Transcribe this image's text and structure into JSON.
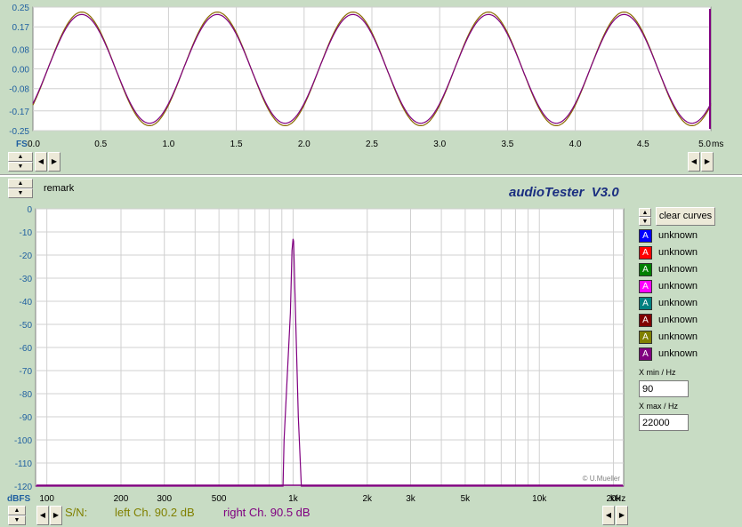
{
  "app": {
    "title": "audioTester  V3.0",
    "copyright": "© U.Mueller",
    "remark_label": "remark"
  },
  "time_plot": {
    "fs_label": "FS",
    "unit": "ms",
    "y_ticks": [
      "0.25",
      "0.17",
      "0.08",
      "0.00",
      "-0.08",
      "-0.17",
      "-0.25"
    ],
    "x_ticks": [
      "0.0",
      "0.5",
      "1.0",
      "1.5",
      "2.0",
      "2.5",
      "3.0",
      "3.5",
      "4.0",
      "4.5",
      "5.0"
    ]
  },
  "freq_plot": {
    "y_unit": "dBFS",
    "x_unit": "kHz",
    "y_ticks": [
      "0",
      "-10",
      "-20",
      "-30",
      "-40",
      "-50",
      "-60",
      "-70",
      "-80",
      "-90",
      "-100",
      "-110",
      "-120"
    ],
    "x_ticks": [
      "100",
      "200",
      "300",
      "500",
      "1k",
      "2k",
      "3k",
      "5k",
      "10k",
      "20k"
    ]
  },
  "chart_data": [
    {
      "type": "line",
      "x_range_ms": [
        0,
        5
      ],
      "ylim": [
        -0.25,
        0.25
      ],
      "series": [
        {
          "color": "#8a6a00",
          "amplitude": 0.23,
          "frequency_hz": 1000
        },
        {
          "color": "#800080",
          "amplitude": 0.22,
          "frequency_hz": 1000
        }
      ]
    },
    {
      "type": "line",
      "x_scale": "log",
      "xlim_hz": [
        90,
        22000
      ],
      "ylim_db": [
        -120,
        0
      ],
      "peak": {
        "frequency_hz": 1000,
        "level_db": -13
      },
      "series": [
        {
          "color": "#800080"
        }
      ]
    }
  ],
  "buttons": {
    "clear_curves": "clear curves"
  },
  "legend": [
    {
      "letter": "A",
      "label": "unknown",
      "color": "#0000ff"
    },
    {
      "letter": "A",
      "label": "unknown",
      "color": "#ff0000"
    },
    {
      "letter": "A",
      "label": "unknown",
      "color": "#008000"
    },
    {
      "letter": "A",
      "label": "unknown",
      "color": "#ff00ff"
    },
    {
      "letter": "A",
      "label": "unknown",
      "color": "#008080"
    },
    {
      "letter": "A",
      "label": "unknown",
      "color": "#800000"
    },
    {
      "letter": "A",
      "label": "unknown",
      "color": "#808000"
    },
    {
      "letter": "A",
      "label": "unknown",
      "color": "#800080"
    }
  ],
  "x_min": {
    "label": "X min / Hz",
    "value": "90"
  },
  "x_max": {
    "label": "X max / Hz",
    "value": "22000"
  },
  "status": {
    "sn_label": "S/N:",
    "left": "left Ch. 90.2 dB",
    "right": "right Ch. 90.5 dB",
    "left_color": "#808000",
    "right_color": "#800080"
  },
  "icons": {
    "up": "▲",
    "down": "▼",
    "left": "◀",
    "right": "▶"
  }
}
